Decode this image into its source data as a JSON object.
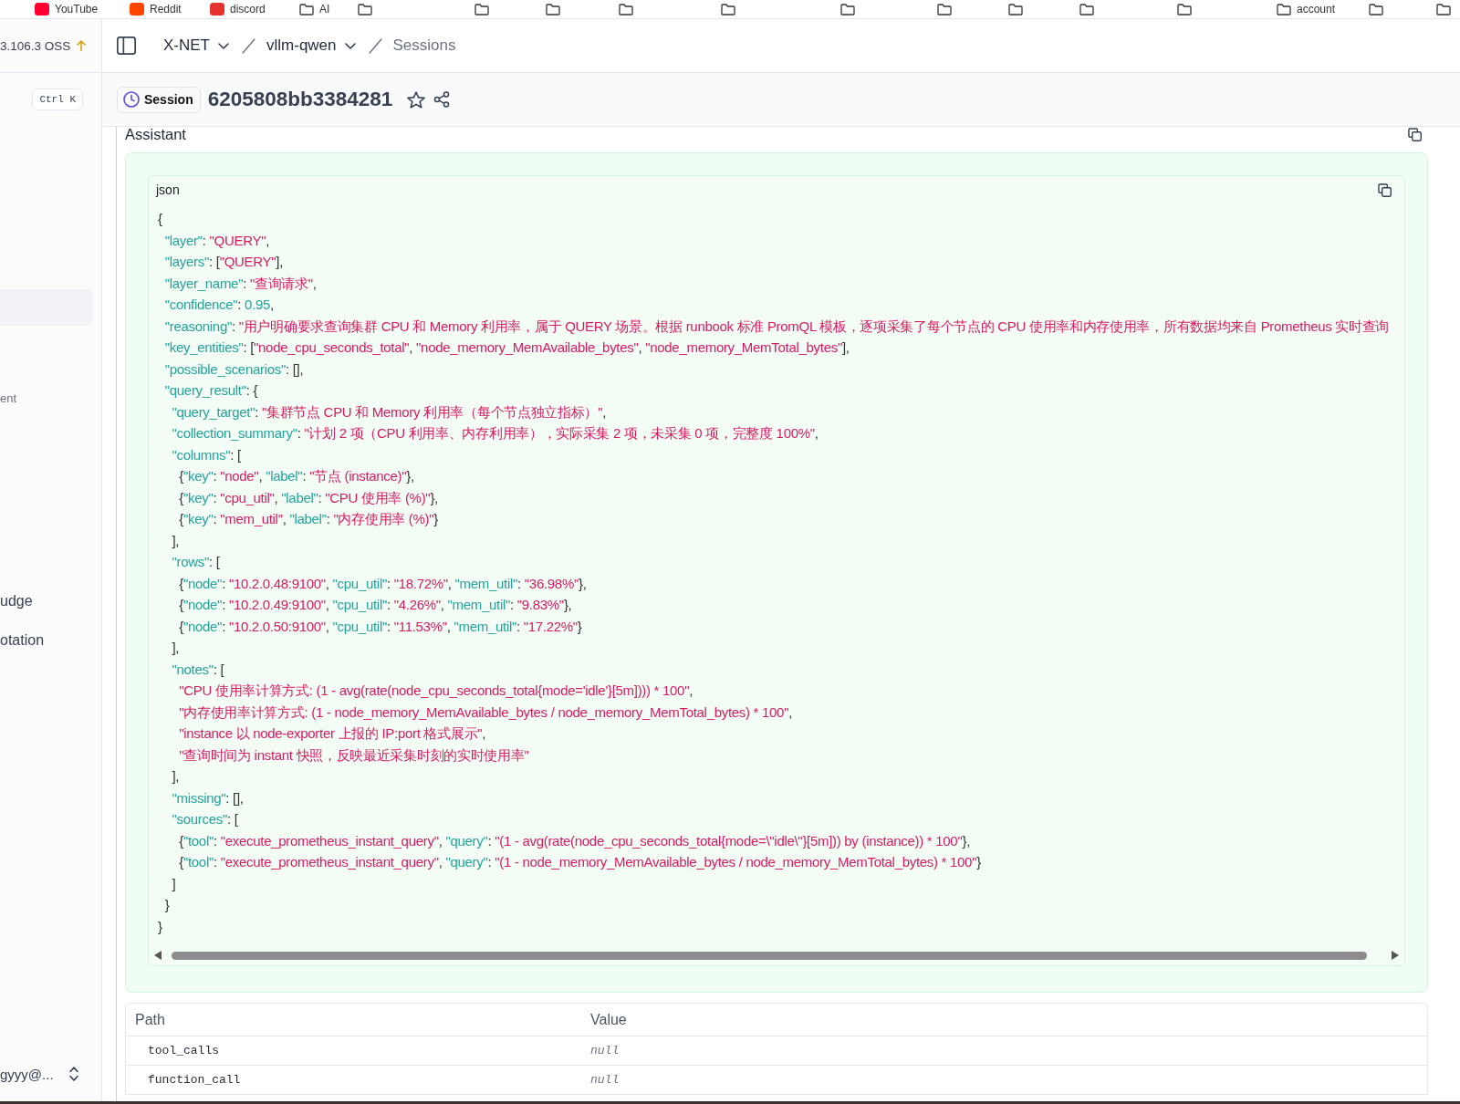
{
  "bookmarks": [
    {
      "kind": "site",
      "label": "YouTube",
      "color": "#ff0033"
    },
    {
      "kind": "site",
      "label": "Reddit",
      "color": "#ff4500"
    },
    {
      "kind": "site",
      "label": "discord",
      "color": "#e5322d"
    },
    {
      "kind": "folder",
      "label": "AI"
    },
    {
      "kind": "folder"
    },
    {
      "kind": "folder"
    },
    {
      "kind": "folder"
    },
    {
      "kind": "folder"
    },
    {
      "kind": "folder"
    },
    {
      "kind": "folder"
    },
    {
      "kind": "folder"
    },
    {
      "kind": "folder"
    },
    {
      "kind": "folder"
    },
    {
      "kind": "folder"
    },
    {
      "kind": "folder",
      "label": "account"
    },
    {
      "kind": "folder"
    },
    {
      "kind": "folder"
    }
  ],
  "sidebar": {
    "version": "3.106.3 OSS",
    "update_available": true,
    "shortcut": "Ctrl K",
    "items": [
      {
        "kind": "nav",
        "selected": true
      },
      {
        "kind": "section",
        "label": "ent"
      },
      {
        "kind": "nav",
        "label": "udge",
        "selected": false
      },
      {
        "kind": "nav",
        "label": "otation",
        "selected": false
      }
    ],
    "user": "gyyy@..."
  },
  "breadcrumbs": [
    {
      "label": "X-NET",
      "kind": "dropdown"
    },
    {
      "label": "vllm-qwen",
      "kind": "dropdown"
    },
    {
      "label": "Sessions",
      "kind": "current"
    }
  ],
  "session": {
    "badge": "Session",
    "id": "6205808bb3384281",
    "starred": false
  },
  "message": {
    "role": "Assistant",
    "code_block": {
      "language": "json",
      "lines": [
        "{",
        "  \"layer\": \"QUERY\",",
        "  \"layers\": [\"QUERY\"],",
        "  \"layer_name\": \"查询请求\",",
        "  \"confidence\": 0.95,",
        "  \"reasoning\": \"用户明确要求查询集群 CPU 和 Memory 利用率，属于 QUERY 场景。根据 runbook 标准 PromQL 模板，逐项采集了每个节点的 CPU 使用率和内存使用率，所有数据均来自 Prometheus 实时查询",
        "  \"key_entities\": [\"node_cpu_seconds_total\", \"node_memory_MemAvailable_bytes\", \"node_memory_MemTotal_bytes\"],",
        "  \"possible_scenarios\": [],",
        "  \"query_result\": {",
        "    \"query_target\": \"集群节点 CPU 和 Memory 利用率（每个节点独立指标）\",",
        "    \"collection_summary\": \"计划 2 项（CPU 利用率、内存利用率），实际采集 2 项，未采集 0 项，完整度 100%\",",
        "    \"columns\": [",
        "      {\"key\": \"node\", \"label\": \"节点 (instance)\"},",
        "      {\"key\": \"cpu_util\", \"label\": \"CPU 使用率 (%)\"},",
        "      {\"key\": \"mem_util\", \"label\": \"内存使用率 (%)\"}",
        "    ],",
        "    \"rows\": [",
        "      {\"node\": \"10.2.0.48:9100\", \"cpu_util\": \"18.72%\", \"mem_util\": \"36.98%\"},",
        "      {\"node\": \"10.2.0.49:9100\", \"cpu_util\": \"4.26%\", \"mem_util\": \"9.83%\"},",
        "      {\"node\": \"10.2.0.50:9100\", \"cpu_util\": \"11.53%\", \"mem_util\": \"17.22%\"}",
        "    ],",
        "    \"notes\": [",
        "      \"CPU 使用率计算方式: (1 - avg(rate(node_cpu_seconds_total{mode='idle'}[5m]))) * 100\",",
        "      \"内存使用率计算方式: (1 - node_memory_MemAvailable_bytes / node_memory_MemTotal_bytes) * 100\",",
        "      \"instance 以 node-exporter 上报的 IP:port 格式展示\",",
        "      \"查询时间为 instant 快照，反映最近采集时刻的实时使用率\"",
        "    ],",
        "    \"missing\": [],",
        "    \"sources\": [",
        "      {\"tool\": \"execute_prometheus_instant_query\", \"query\": \"(1 - avg(rate(node_cpu_seconds_total{mode=\\\"idle\\\"}[5m])) by (instance)) * 100\"},",
        "      {\"tool\": \"execute_prometheus_instant_query\", \"query\": \"(1 - node_memory_MemAvailable_bytes / node_memory_MemTotal_bytes) * 100\"}",
        "    ]",
        "  }",
        "}"
      ]
    }
  },
  "table": {
    "columns": [
      "Path",
      "Value"
    ],
    "rows": [
      [
        "tool_calls",
        "null"
      ],
      [
        "function_call",
        "null"
      ]
    ]
  }
}
